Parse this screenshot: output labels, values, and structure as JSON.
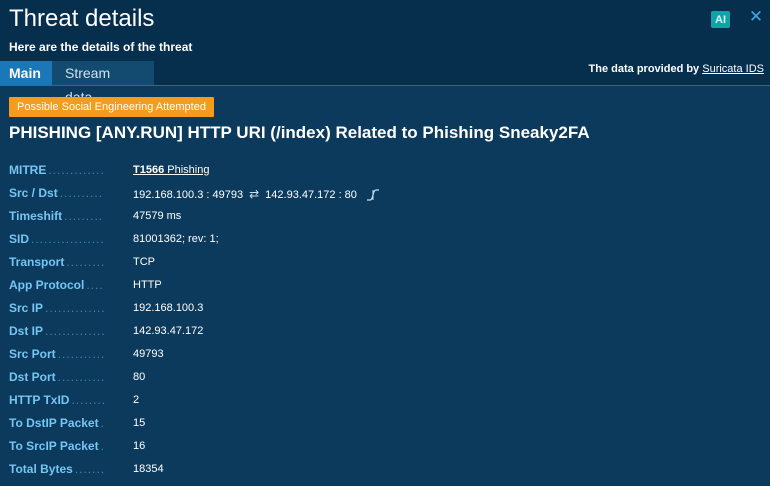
{
  "header": {
    "title": "Threat details",
    "subtitle": "Here are the details of the threat",
    "ai_label": "AI",
    "close_icon": "close-icon"
  },
  "tabs": [
    {
      "label": "Main",
      "active": true
    },
    {
      "label": "Stream data",
      "active": false
    }
  ],
  "provider": {
    "prefix": "The data provided by",
    "link": "Suricata IDS"
  },
  "threat": {
    "category": "Possible Social Engineering Attempted",
    "signature": "PHISHING [ANY.RUN] HTTP URI (/index) Related to Phishing Sneaky2FA"
  },
  "details": {
    "mitre": {
      "label": "MITRE",
      "id": "T1566",
      "name": "Phishing"
    },
    "src_dst": {
      "label": "Src / Dst",
      "src": "192.168.100.3 : 49793",
      "dst": "142.93.47.172 : 80"
    },
    "timeshift": {
      "label": "Timeshift",
      "value": "47579 ms"
    },
    "sid": {
      "label": "SID",
      "value": "81001362; rev: 1;"
    },
    "transport": {
      "label": "Transport",
      "value": "TCP"
    },
    "app_protocol": {
      "label": "App Protocol",
      "value": "HTTP"
    },
    "src_ip": {
      "label": "Src IP",
      "value": "192.168.100.3"
    },
    "dst_ip": {
      "label": "Dst IP",
      "value": "142.93.47.172"
    },
    "src_port": {
      "label": "Src Port",
      "value": "49793"
    },
    "dst_port": {
      "label": "Dst Port",
      "value": "80"
    },
    "http_txid": {
      "label": "HTTP TxID",
      "value": "2"
    },
    "to_dstip_packet": {
      "label": "To DstIP Packet",
      "value": "15"
    },
    "to_srcip_packet": {
      "label": "To SrcIP Packet",
      "value": "16"
    },
    "total_bytes": {
      "label": "Total Bytes",
      "value": "18354"
    }
  },
  "colors": {
    "background": "#0b3a5c",
    "header": "#062e4d",
    "active_tab": "#1a78b9",
    "category_badge": "#f59b1d",
    "label": "#76c5f3",
    "ai_badge": "#0fa5a8"
  }
}
